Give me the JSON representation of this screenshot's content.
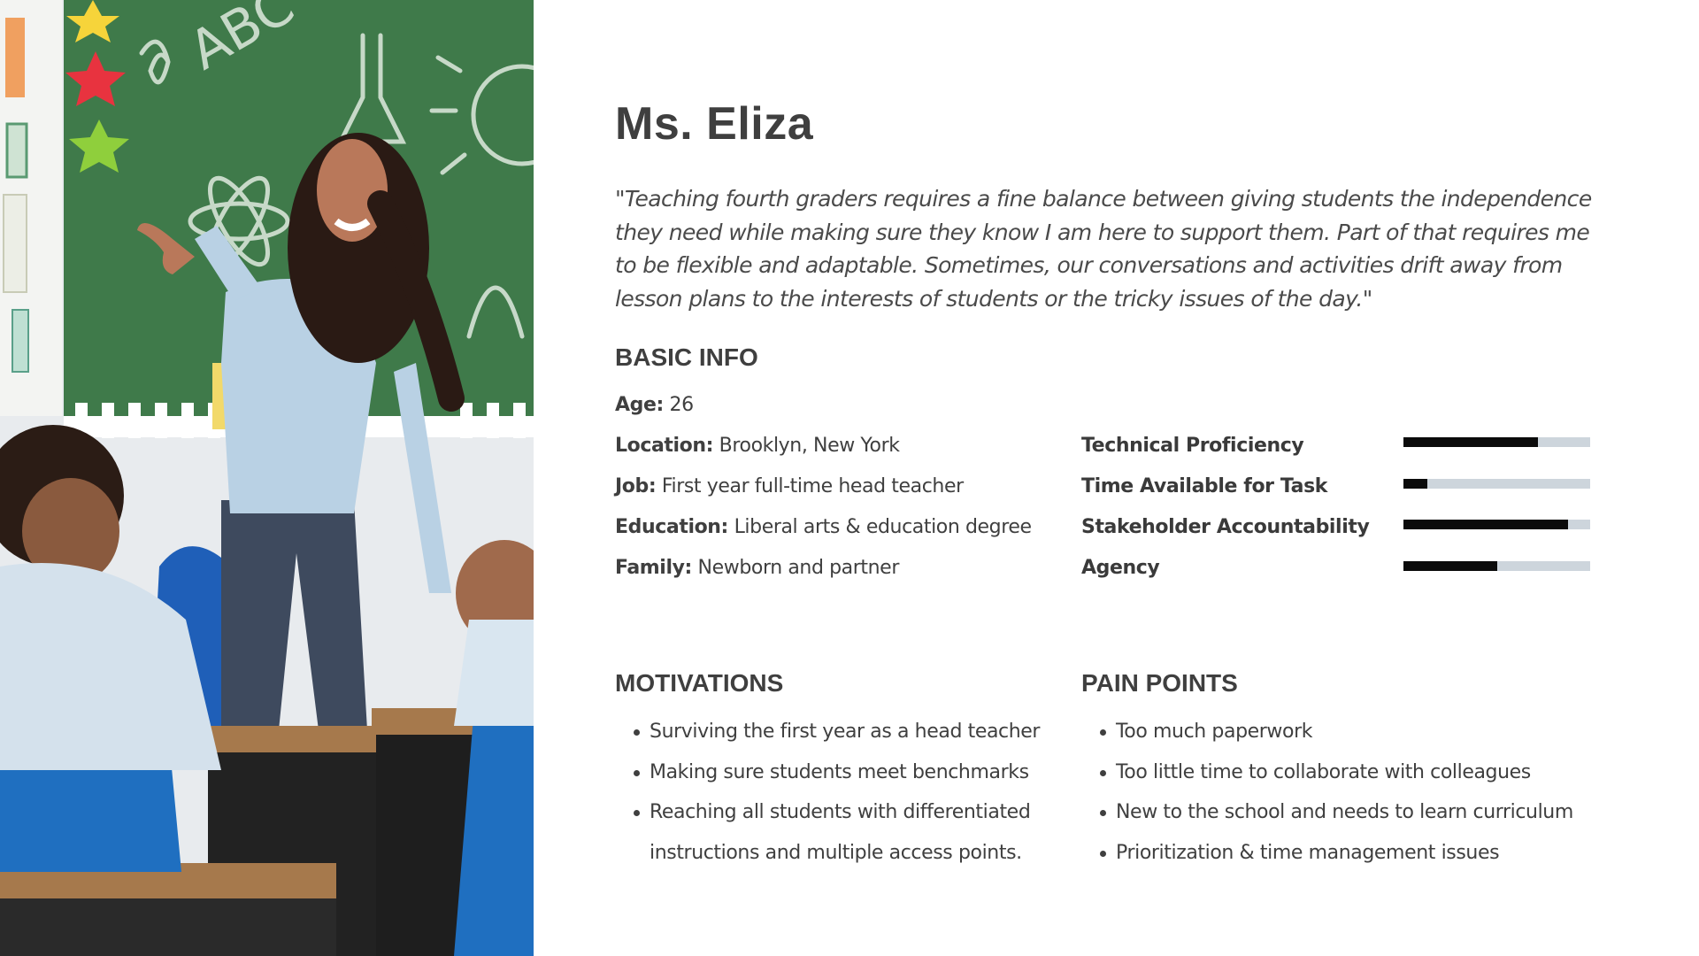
{
  "persona": {
    "name": "Ms. Eliza",
    "quote": "\"Teaching fourth graders requires a fine balance between giving students the independence they need while making sure they know I am here to support them. Part of that requires me to be flexible and adaptable. Sometimes, our conversations and activities drift away from lesson plans to the interests of students or the tricky issues of the day.\""
  },
  "basic_info": {
    "title": "BASIC INFO",
    "age": {
      "label": "Age:",
      "value": "26"
    },
    "location": {
      "label": "Location:",
      "value": "Brooklyn, New York"
    },
    "job": {
      "label": "Job:",
      "value": "First year full-time head teacher"
    },
    "education": {
      "label": "Education:",
      "value": "Liberal arts & education degree"
    },
    "family": {
      "label": "Family:",
      "value": "Newborn and partner"
    }
  },
  "meters": [
    {
      "label": "Technical Proficiency",
      "level_pct": 72
    },
    {
      "label": "Time Available for Task",
      "level_pct": 13
    },
    {
      "label": "Stakeholder Accountability",
      "level_pct": 88
    },
    {
      "label": "Agency",
      "level_pct": 50
    }
  ],
  "motivations": {
    "title": "MOTIVATIONS",
    "items": [
      "Surviving the first year as a head teacher",
      "Making sure students meet benchmarks",
      "Reaching all students with differentiated instructions and multiple access points."
    ]
  },
  "pain_points": {
    "title": "PAIN POINTS",
    "items": [
      "Too much paperwork",
      "Too little time to collaborate with colleagues",
      "New to the school and needs to learn curriculum",
      "Prioritization & time management issues"
    ]
  },
  "colors": {
    "text": "#3f3f3f",
    "meter_fill": "#0b0b0b",
    "meter_track": "#cdd5dc",
    "chalkboard": "#3f7a4a"
  }
}
